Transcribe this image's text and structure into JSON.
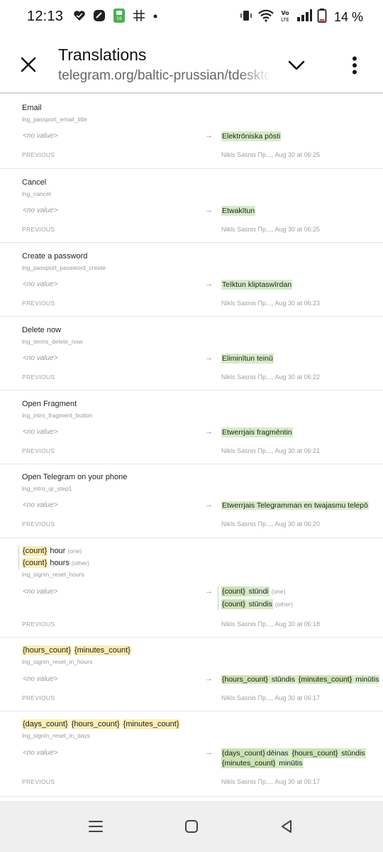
{
  "status_bar": {
    "time": "12:13",
    "battery": "14 %",
    "left_icons": [
      "heart-app-icon",
      "blue-app-icon",
      "green-app-icon",
      "grid-app-icon",
      "dot-icon"
    ],
    "right_icons": [
      "vibrate-icon",
      "wifi-icon",
      "volte-icon",
      "signal-icon",
      "battery-icon"
    ],
    "volte_text": "Vo LTE"
  },
  "app_bar": {
    "title": "Translations",
    "url": "telegram.org/baltic-prussian/tdesktop"
  },
  "labels": {
    "no_value": "<no value>",
    "arrow": "→",
    "previous": "PREVIOUS",
    "form_one": "(one)",
    "form_other": "(other)"
  },
  "entries": [
    {
      "title": "Email",
      "key": "lng_passport_email_title",
      "translation": "Elektrōniska pōsti",
      "meta": "Nikls Sasnis Пр..., Aug 30 at 06:25"
    },
    {
      "title": "Cancel",
      "key": "lng_cancel",
      "translation": "Etwakītun",
      "meta": "Nikls Sasnis Пр..., Aug 30 at 06:25"
    },
    {
      "title": "Create a password",
      "key": "lng_passport_password_create",
      "translation": "Teīktun kliptaswīrdan",
      "meta": "Nikls Sasnis Пр..., Aug 30 at 06:23"
    },
    {
      "title": "Delete now",
      "key": "lng_terms_delete_now",
      "translation": "Eliminītun teinū",
      "meta": "Nikls Sasnis Пр..., Aug 30 at 06:22"
    },
    {
      "title": "Open Fragment",
      "key": "lng_intro_fragment_button",
      "translation": "Etwerrjais fragmēntin",
      "meta": "Nikls Sasnis Пр..., Aug 30 at 06:21"
    },
    {
      "title": "Open Telegram on your phone",
      "key": "lng_intro_qr_step1",
      "translation": "Etwerrjais Telegramman en twajasmu telepō",
      "meta": "Nikls Sasnis Пр..., Aug 30 at 06:20"
    },
    {
      "title_one_var": "{count}",
      "title_one_text": " hour",
      "title_other_var": "{count}",
      "title_other_text": " hours",
      "key": "lng_signin_reset_hours",
      "translation_one_var": "{count}",
      "translation_one_text": " stūndi",
      "translation_other_var": "{count}",
      "translation_other_text": " stūndis",
      "meta": "Nikls Sasnis Пр..., Aug 30 at 06:18"
    },
    {
      "title_parts": [
        "{hours_count}",
        " ",
        "{minutes_count}"
      ],
      "key": "lng_signin_reset_in_hours",
      "translation_parts": [
        "{hours_count}",
        "  stūndis ",
        "{minutes_count}",
        " minūtis"
      ],
      "meta": "Nikls Sasnis Пр..., Aug 30 at 06:17"
    },
    {
      "title_parts": [
        "{days_count}",
        " ",
        "{hours_count}",
        " ",
        "{minutes_count}"
      ],
      "key": "lng_signin_reset_in_days",
      "translation_line1": [
        "{days_count}",
        "dēinas ",
        "{hours_count}",
        " stūndis"
      ],
      "translation_line2": [
        "{minutes_count}",
        " minūtis"
      ],
      "meta": "Nikls Sasnis Пр..., Aug 30 at 06:17"
    }
  ],
  "nav_bar": {
    "icons": [
      "recents-icon",
      "home-icon",
      "back-icon"
    ]
  }
}
